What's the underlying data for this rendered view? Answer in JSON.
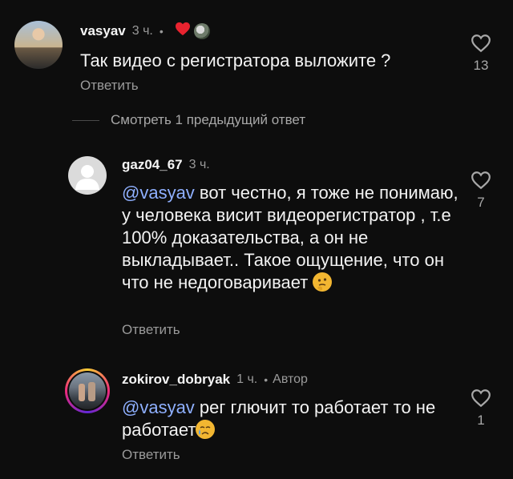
{
  "comments": [
    {
      "username": "vasyav",
      "time": "3 ч.",
      "text": "Так видео с регистратора выложите ?",
      "reply_label": "Ответить",
      "like_count": "13",
      "reactions": [
        "heart-icon",
        "reactor-avatar"
      ]
    },
    {
      "username": "gaz04_67",
      "time": "3 ч.",
      "mention": "@vasyav",
      "text": " вот честно, я тоже не понимаю, у человека висит видеорегистратор , т.е 100% доказательства, а он не выкладывает.. Такое ощущение, что он что не недоговаривает ",
      "emoji": "thinking-face",
      "reply_label": "Ответить",
      "like_count": "7"
    },
    {
      "username": "zokirov_dobryak",
      "time": "1 ч.",
      "author_badge": "Автор",
      "mention": "@vasyav",
      "text": " рег глючит то работает то не работает",
      "emoji": "crying-face",
      "reply_label": "Ответить",
      "like_count": "1"
    }
  ],
  "view_replies_label": "Смотреть 1 предыдущий ответ",
  "colors": {
    "background": "#0d0d0d",
    "mention": "#8fb0ff",
    "heart": "#e8232f",
    "muted": "#9a9a9a"
  }
}
